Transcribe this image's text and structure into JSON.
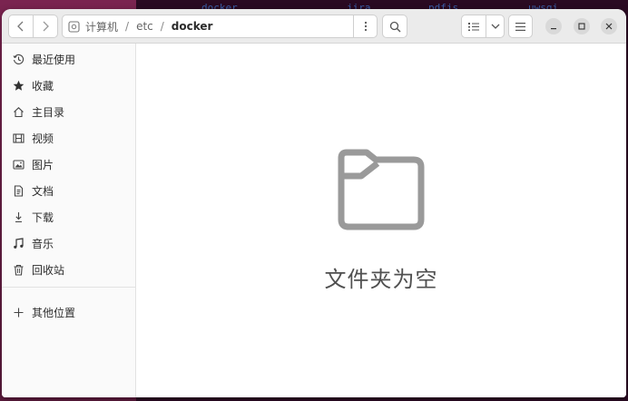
{
  "background": {
    "terminal_words": [
      "docker",
      "jira",
      "pdfjs",
      "uwsgi"
    ]
  },
  "window": {
    "pathbar": {
      "root_label": "计算机",
      "segments": [
        "etc"
      ],
      "current": "docker"
    }
  },
  "sidebar": {
    "items": [
      {
        "label": "最近使用",
        "icon": "clock-icon"
      },
      {
        "label": "收藏",
        "icon": "star-icon"
      },
      {
        "label": "主目录",
        "icon": "home-icon"
      },
      {
        "label": "视频",
        "icon": "film-icon"
      },
      {
        "label": "图片",
        "icon": "image-icon"
      },
      {
        "label": "文档",
        "icon": "document-icon"
      },
      {
        "label": "下载",
        "icon": "download-icon"
      },
      {
        "label": "音乐",
        "icon": "music-icon"
      },
      {
        "label": "回收站",
        "icon": "trash-icon"
      }
    ],
    "other_locations": {
      "label": "其他位置",
      "icon": "plus-icon"
    }
  },
  "main": {
    "empty_message": "文件夹为空",
    "empty_icon": "folder-icon"
  },
  "colors": {
    "accent_text": "#303030",
    "icon_gray": "#9a9a9a",
    "headerbar_bg": "#ebebeb"
  }
}
